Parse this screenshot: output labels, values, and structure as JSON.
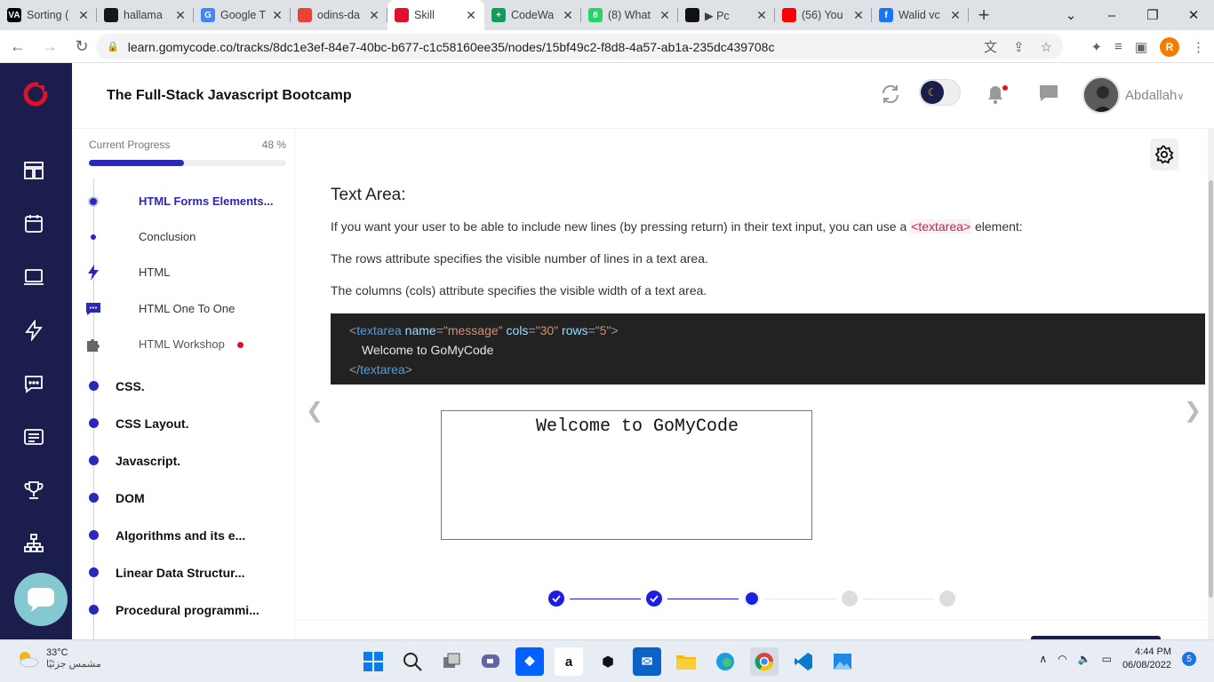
{
  "browser": {
    "tabs": [
      {
        "title": "Sorting (",
        "favicon": "codewars-va-icon",
        "color": "#000000",
        "letter": "VA",
        "active": false
      },
      {
        "title": "hallama",
        "favicon": "github-icon",
        "color": "#181717",
        "letter": "",
        "active": false
      },
      {
        "title": "Google T",
        "favicon": "google-translate-icon",
        "color": "#4285f4",
        "letter": "G",
        "active": false
      },
      {
        "title": "odins-da",
        "favicon": "chrome-web-icon",
        "color": "#ea4335",
        "letter": "",
        "active": false
      },
      {
        "title": "Skill",
        "favicon": "gomycode-icon",
        "color": "#e0102b",
        "letter": "",
        "active": true
      },
      {
        "title": "CodeWa",
        "favicon": "sheets-plus-icon",
        "color": "#0f9d58",
        "letter": "+",
        "active": false
      },
      {
        "title": "(8) What",
        "favicon": "whatsapp-icon",
        "color": "#25d366",
        "letter": "8",
        "active": false
      },
      {
        "title": "▶ Pc",
        "favicon": "podcast-icon",
        "color": "#111111",
        "letter": "",
        "active": false
      },
      {
        "title": "(56) You",
        "favicon": "youtube-icon",
        "color": "#ff0000",
        "letter": "",
        "active": false
      },
      {
        "title": "Walid vc",
        "favicon": "facebook-icon",
        "color": "#1877f2",
        "letter": "f",
        "active": false
      }
    ],
    "url": "learn.gomycode.co/tracks/8dc1e3ef-84e7-40bc-b677-c1c58160ee35/nodes/15bf49c2-f8d8-4a57-ab1a-235dc439708c",
    "profile_letter": "R"
  },
  "header": {
    "title": "The Full-Stack Javascript Bootcamp",
    "username": "Abdallah"
  },
  "sidebar": {
    "progress_label": "Current Progress",
    "progress_value": "48 %",
    "progress_fraction": 0.48,
    "subitems": [
      {
        "label": "HTML Forms Elements...",
        "icon": "dot-icon",
        "current": true
      },
      {
        "label": "Conclusion",
        "icon": "dot-icon",
        "current": false
      },
      {
        "label": "HTML",
        "icon": "lightning-icon",
        "current": false
      },
      {
        "label": "HTML One To One",
        "icon": "chat-icon",
        "current": false
      },
      {
        "label": "HTML Workshop",
        "icon": "puzzle-icon",
        "current": false,
        "badge": "red-dot"
      }
    ],
    "sections": [
      {
        "label": "CSS."
      },
      {
        "label": "CSS Layout."
      },
      {
        "label": "Javascript."
      },
      {
        "label": "DOM"
      },
      {
        "label": "Algorithms and its e..."
      },
      {
        "label": "Linear Data Structur..."
      },
      {
        "label": "Procedural programmi..."
      }
    ]
  },
  "content": {
    "heading": "Text Area:",
    "para1_before": "If you want your user to be able to include new lines (by pressing return) in their text input, you can use a ",
    "para1_tag": "<textarea>",
    "para1_after": " element:",
    "para2": "The rows attribute specifies the visible number of lines in a text area.",
    "para3": "The columns (cols) attribute specifies the visible width of a text area.",
    "code": {
      "open_tag": "textarea",
      "attr1_name": "name",
      "attr1_value": "\"message\"",
      "attr2_name": "cols",
      "attr2_value": "\"30\"",
      "attr3_name": "rows",
      "attr3_value": "\"5\"",
      "body": "Welcome to GoMyCode",
      "close_tag": "textarea"
    },
    "demo_textarea_value": "Welcome to GoMyCode",
    "stepper": {
      "total": 5,
      "completed": 2,
      "current": 3
    }
  },
  "taskbar": {
    "temperature": "33°C",
    "weather_text": "مشمس جزئيًا",
    "time": "4:44 PM",
    "date": "06/08/2022",
    "notification_count": "5"
  },
  "colors": {
    "rail": "#1b1d4d",
    "accent": "#2c27b8",
    "brand_red": "#e0102b",
    "code_bg": "#222222"
  }
}
